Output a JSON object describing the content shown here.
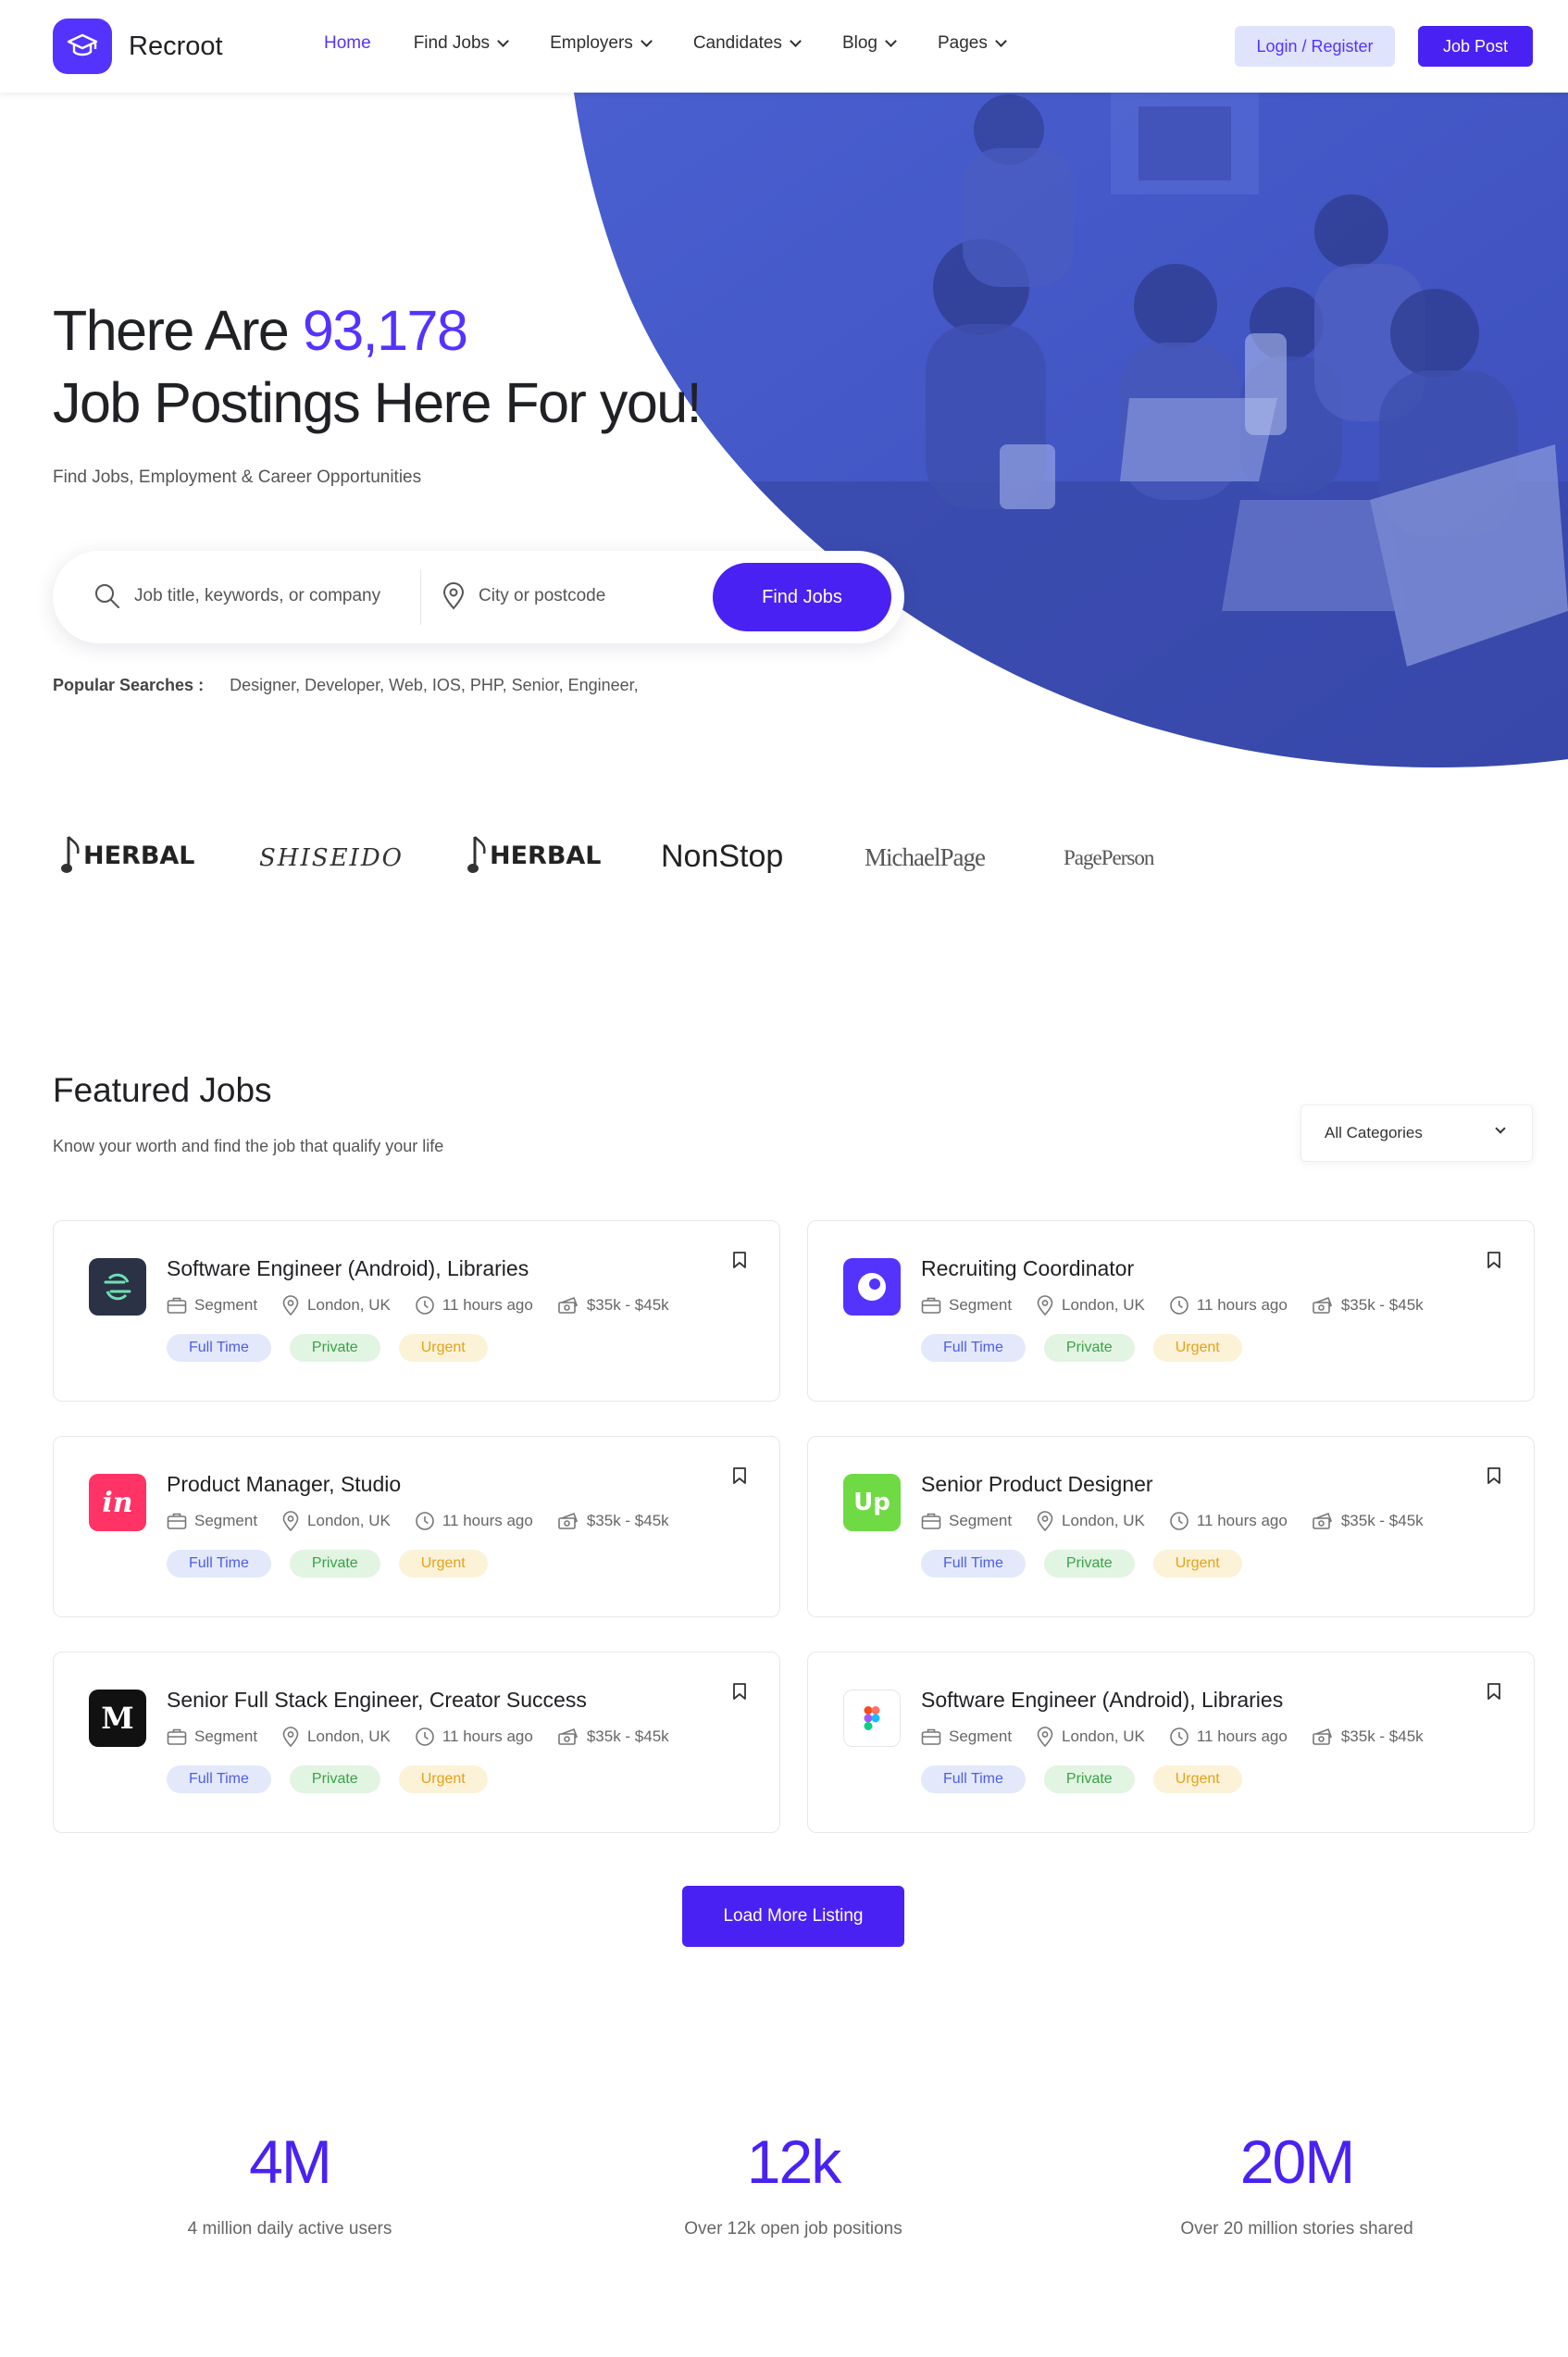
{
  "header": {
    "brand": "Recroot",
    "nav": [
      {
        "label": "Home",
        "active": true,
        "dropdown": false
      },
      {
        "label": "Find Jobs",
        "active": false,
        "dropdown": true
      },
      {
        "label": "Employers",
        "active": false,
        "dropdown": true
      },
      {
        "label": "Candidates",
        "active": false,
        "dropdown": true
      },
      {
        "label": "Blog",
        "active": false,
        "dropdown": true
      },
      {
        "label": "Pages",
        "active": false,
        "dropdown": true
      }
    ],
    "login_label": "Login / Register",
    "post_label": "Job Post"
  },
  "hero": {
    "title_prefix": "There Are ",
    "count": "93,178",
    "title_line2": "Job Postings Here For you!",
    "subtitle": "Find Jobs, Employment & Career Opportunities",
    "search": {
      "keyword_placeholder": "Job title, keywords, or company",
      "location_placeholder": "City or postcode",
      "button": "Find Jobs"
    },
    "popular_label": "Popular Searches :",
    "popular_terms": "Designer, Developer, Web, IOS, PHP, Senior, Engineer,"
  },
  "brands": [
    "HERBAL",
    "SHISEIDO",
    "HERBAL",
    "NonStop",
    "MichaelPage",
    "PagePerson"
  ],
  "featured": {
    "title": "Featured Jobs",
    "subtitle": "Know your worth and find the job that qualify your life",
    "category_select": "All Categories",
    "jobs": [
      {
        "title": "Software Engineer (Android), Libraries",
        "company": "Segment",
        "location": "London, UK",
        "posted": "11 hours ago",
        "salary": "$35k - $45k",
        "logo": "segment-logo",
        "logo_color": "#2b3245"
      },
      {
        "title": "Recruiting Coordinator",
        "company": "Segment",
        "location": "London, UK",
        "posted": "11 hours ago",
        "salary": "$35k - $45k",
        "logo": "circle-logo",
        "logo_color": "#5433ff"
      },
      {
        "title": "Product Manager, Studio",
        "company": "Segment",
        "location": "London, UK",
        "posted": "11 hours ago",
        "salary": "$35k - $45k",
        "logo": "invision-logo",
        "logo_color": "#ff3366"
      },
      {
        "title": "Senior Product Designer",
        "company": "Segment",
        "location": "London, UK",
        "posted": "11 hours ago",
        "salary": "$35k - $45k",
        "logo": "upwork-logo",
        "logo_color": "#6fda44"
      },
      {
        "title": "Senior Full Stack Engineer, Creator Success",
        "company": "Segment",
        "location": "London, UK",
        "posted": "11 hours ago",
        "salary": "$35k - $45k",
        "logo": "medium-logo",
        "logo_color": "#111111"
      },
      {
        "title": "Software Engineer (Android), Libraries",
        "company": "Segment",
        "location": "London, UK",
        "posted": "11 hours ago",
        "salary": "$35k - $45k",
        "logo": "figma-logo",
        "logo_color": "#ffffff"
      }
    ],
    "tags": [
      "Full Time",
      "Private",
      "Urgent"
    ],
    "load_more": "Load More Listing"
  },
  "stats": [
    {
      "value": "4M",
      "label": "4 million daily active users"
    },
    {
      "value": "12k",
      "label": "Over 12k open job positions"
    },
    {
      "value": "20M",
      "label": "Over 20 million stories shared"
    }
  ],
  "colors": {
    "accent": "#5433ff",
    "button": "#4a21f3"
  }
}
